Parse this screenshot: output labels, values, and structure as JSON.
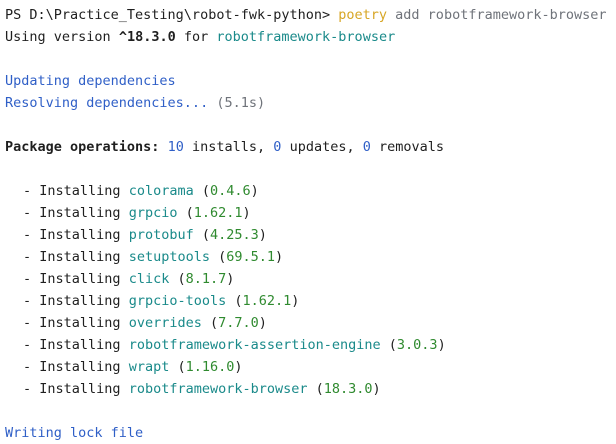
{
  "colors": {
    "default": "#1f1f1f",
    "gray": "#6f737a",
    "yellow": "#d7a625",
    "teal": "#1a8a8a",
    "blue": "#2f5fc7",
    "green": "#2f8a2f"
  },
  "prompt": {
    "path": "PS D:\\Practice_Testing\\robot-fwk-python>",
    "command_tool": "poetry",
    "command_args": "add robotframework-browser"
  },
  "version_line": {
    "prefix": "Using version",
    "version": "^18.3.0",
    "middle": "for",
    "package": "robotframework-browser"
  },
  "status": {
    "updating": "Updating dependencies",
    "resolving": "Resolving dependencies...",
    "resolving_time": "(5.1s)"
  },
  "package_ops": {
    "label": "Package operations:",
    "installs_count": "10",
    "installs_label": "installs,",
    "updates_count": "0",
    "updates_label": "updates,",
    "removals_count": "0",
    "removals_label": "removals"
  },
  "install_prefix": "- Installing",
  "installs": [
    {
      "name": "colorama",
      "version": "0.4.6"
    },
    {
      "name": "grpcio",
      "version": "1.62.1"
    },
    {
      "name": "protobuf",
      "version": "4.25.3"
    },
    {
      "name": "setuptools",
      "version": "69.5.1"
    },
    {
      "name": "click",
      "version": "8.1.7"
    },
    {
      "name": "grpcio-tools",
      "version": "1.62.1"
    },
    {
      "name": "overrides",
      "version": "7.7.0"
    },
    {
      "name": "robotframework-assertion-engine",
      "version": "3.0.3"
    },
    {
      "name": "wrapt",
      "version": "1.16.0"
    },
    {
      "name": "robotframework-browser",
      "version": "18.3.0"
    }
  ],
  "footer": {
    "writing_lock": "Writing lock file"
  }
}
